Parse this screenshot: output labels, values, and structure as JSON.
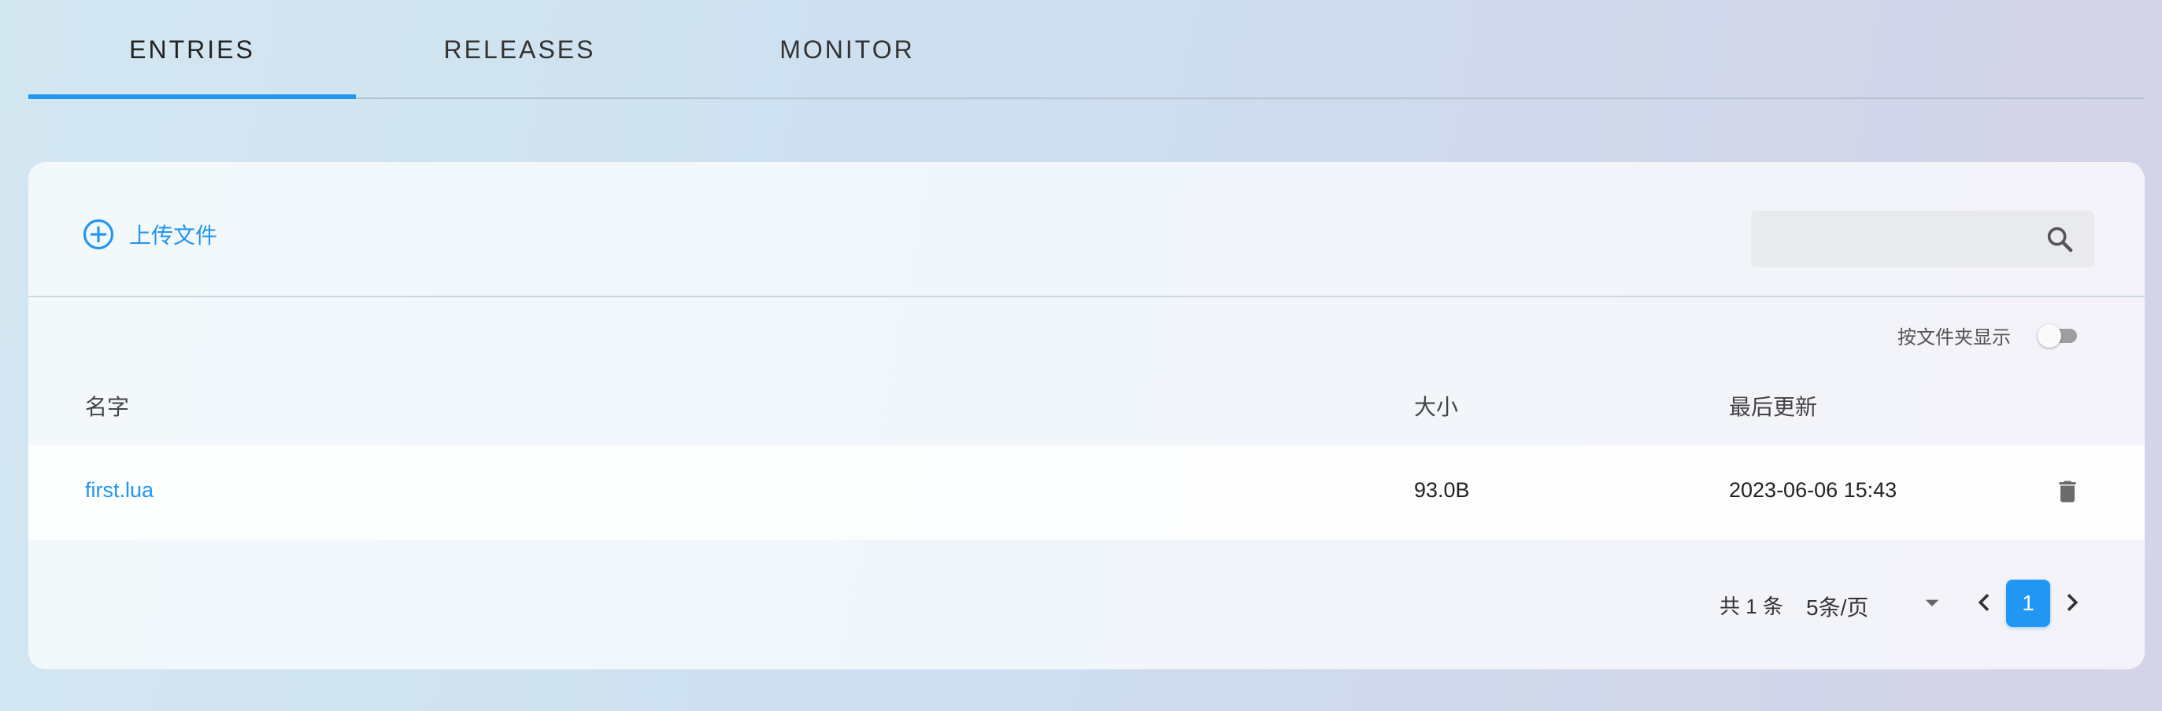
{
  "tabs": [
    {
      "label": "ENTRIES",
      "active": true
    },
    {
      "label": "RELEASES",
      "active": false
    },
    {
      "label": "MONITOR",
      "active": false
    }
  ],
  "toolbar": {
    "upload_label": "上传文件",
    "upload_icon": "plus-circle-icon",
    "search_placeholder": "",
    "search_icon": "search-icon"
  },
  "folder_toggle": {
    "label": "按文件夹显示",
    "on": false
  },
  "table": {
    "headers": {
      "name": "名字",
      "size": "大小",
      "updated": "最后更新"
    },
    "rows": [
      {
        "name": "first.lua",
        "size": "93.0B",
        "updated": "2023-06-06 15:43",
        "action_icon": "delete-icon"
      }
    ]
  },
  "pagination": {
    "total": "共 1 条",
    "per_page": "5条/页",
    "current_page": "1"
  },
  "colors": {
    "accent": "#2196f3",
    "text": "#333333"
  }
}
